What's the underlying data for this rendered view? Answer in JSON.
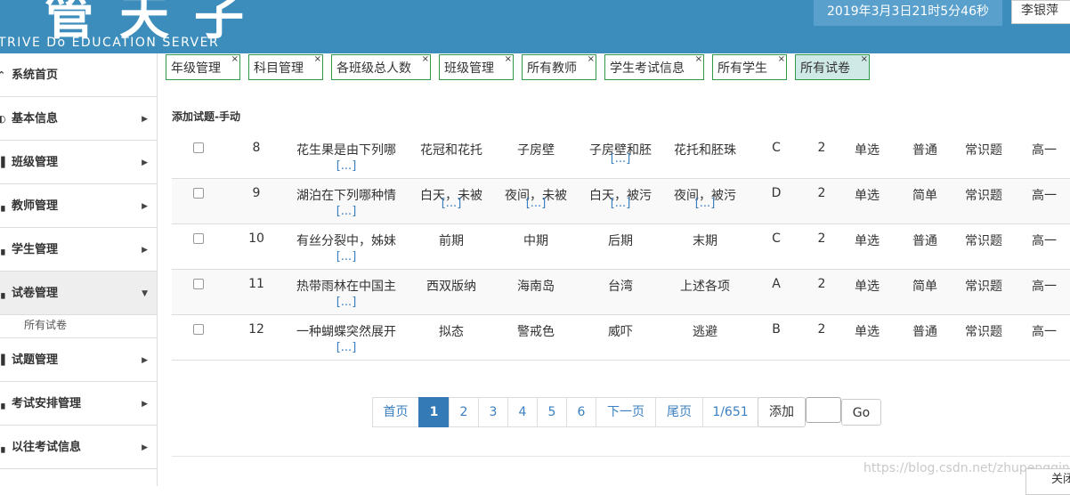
{
  "header": {
    "logo_text": "管天子",
    "logo_subtitle": "TRIVE Do EDUCATION SERVER",
    "clock": "2019年3月3日21时5分46秒",
    "user": "李银萍"
  },
  "sidebar": {
    "items": [
      {
        "label": "系统首页",
        "arrow": ""
      },
      {
        "label": "基本信息",
        "arrow": "▶"
      },
      {
        "label": "班级管理",
        "arrow": "▶"
      },
      {
        "label": "教师管理",
        "arrow": "▶"
      },
      {
        "label": "学生管理",
        "arrow": "▶"
      },
      {
        "label": "试卷管理",
        "arrow": "▼"
      },
      {
        "label": "试题管理",
        "arrow": "▶"
      },
      {
        "label": "考试安排管理",
        "arrow": "▶"
      },
      {
        "label": "以往考试信息",
        "arrow": "▶"
      }
    ],
    "sub_item": "所有试卷"
  },
  "tabs": [
    {
      "label": "年级管理",
      "close": "×"
    },
    {
      "label": "科目管理",
      "close": "×"
    },
    {
      "label": "各班级总人数",
      "close": "×"
    },
    {
      "label": "班级管理",
      "close": "×"
    },
    {
      "label": "所有教师",
      "close": "×"
    },
    {
      "label": "学生考试信息",
      "close": "×"
    },
    {
      "label": "所有学生",
      "close": "×"
    },
    {
      "label": "所有试卷",
      "close": "×"
    }
  ],
  "section_title": "添加试题-手动",
  "rows": [
    {
      "id": "8",
      "question": "花生果是由下列哪",
      "a": "花冠和花托",
      "b": "子房壁",
      "c": "子房壁和胚",
      "d": "花托和胚珠",
      "answer": "C",
      "score": "2",
      "type": "单选",
      "difficulty": "普通",
      "category": "常识题",
      "grade": "高一"
    },
    {
      "id": "9",
      "question": "湖泊在下列哪种情",
      "a": "白天，未被",
      "b": "夜间，未被",
      "c": "白天，被污",
      "d": "夜间，被污",
      "answer": "D",
      "score": "2",
      "type": "单选",
      "difficulty": "简单",
      "category": "常识题",
      "grade": "高一"
    },
    {
      "id": "10",
      "question": "有丝分裂中，姊妹",
      "a": "前期",
      "b": "中期",
      "c": "后期",
      "d": "末期",
      "answer": "C",
      "score": "2",
      "type": "单选",
      "difficulty": "普通",
      "category": "常识题",
      "grade": "高一"
    },
    {
      "id": "11",
      "question": "热带雨林在中国主",
      "a": "西双版纳",
      "b": "海南岛",
      "c": "台湾",
      "d": "上述各项",
      "answer": "A",
      "score": "2",
      "type": "单选",
      "difficulty": "简单",
      "category": "常识题",
      "grade": "高一"
    },
    {
      "id": "12",
      "question": "一种蝴蝶突然展开",
      "a": "拟态",
      "b": "警戒色",
      "c": "威吓",
      "d": "逃避",
      "answer": "B",
      "score": "2",
      "type": "单选",
      "difficulty": "普通",
      "category": "常识题",
      "grade": "高一"
    }
  ],
  "more": "[...]",
  "pager": {
    "first": "首页",
    "pages": [
      "1",
      "2",
      "3",
      "4",
      "5",
      "6"
    ],
    "next": "下一页",
    "last": "尾页",
    "info": "1/651",
    "current": "1"
  },
  "add_label": "添加",
  "go_label": "Go",
  "watermark": "https://blog.csdn.net/zhupengqin",
  "close_label": "关闭"
}
